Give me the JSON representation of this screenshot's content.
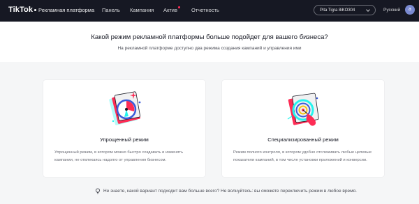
{
  "header": {
    "logo_main": "TikTok",
    "logo_sub": "Рекламная платформа",
    "nav": [
      {
        "label": "Панель"
      },
      {
        "label": "Кампания"
      },
      {
        "label": "Актив"
      },
      {
        "label": "Отчетность"
      }
    ],
    "account_name": "Pita Tigra 8iKO304",
    "language": "Русский",
    "avatar_letter": "a"
  },
  "hero": {
    "title": "Какой режим рекламной платформы больше подойдет для вашего бизнеса?",
    "subtitle": "На рекламной платформе доступно два режима создания кампаний и управления ими"
  },
  "modes": [
    {
      "title": "Упрощенный режим",
      "description": "Упрощенный режим, в котором можно быстро создавать и изменять кампании, не отвлекаясь надолго от управления бизнесом.",
      "icon": "compass-icon"
    },
    {
      "title": "Специализированный режим",
      "description": "Режим полного контроля, в котором удобно отслеживать любые целевые показатели кампаний, в том числе установки приложений и конверсии.",
      "icon": "target-click-icon"
    }
  ],
  "hint": {
    "text": "Не знаете, какой вариант подходит вам больше всего? Не волнуйтесь: вы сможете переключить режим в любое время.",
    "icon": "lightbulb-icon"
  },
  "colors": {
    "topbar": "#161823",
    "accent_red": "#fe2c55",
    "accent_cyan": "#25f4ee",
    "page_bg": "#f5f6f7"
  }
}
